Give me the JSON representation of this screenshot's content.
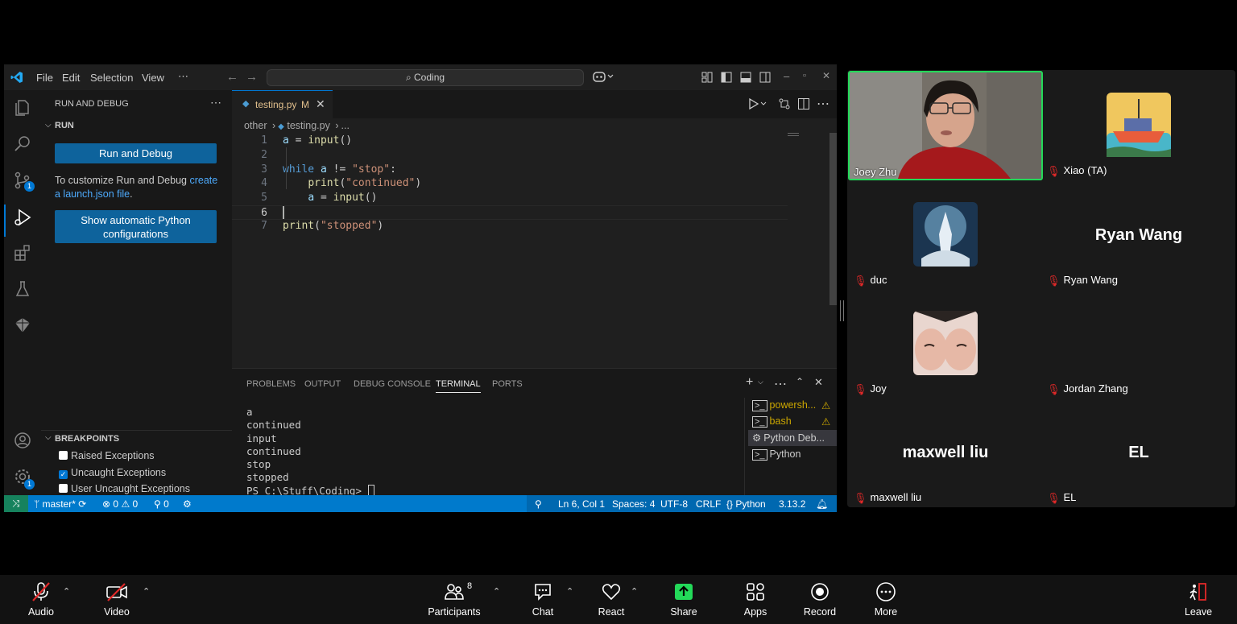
{
  "vscode": {
    "menu": [
      "File",
      "Edit",
      "Selection",
      "View",
      "⋯"
    ],
    "search_text": "Coding",
    "sidebar": {
      "title": "RUN AND DEBUG",
      "section": "RUN",
      "run_button": "Run and Debug",
      "customize_text": "To customize Run and Debug ",
      "create_link": "create",
      "launch_link": "a launch.json file",
      "period": ".",
      "python_button_1": "Show automatic Python",
      "python_button_2": "configurations",
      "breakpoints_title": "BREAKPOINTS",
      "breakpoints": [
        {
          "label": "Raised Exceptions",
          "checked": false
        },
        {
          "label": "Uncaught Exceptions",
          "checked": true
        },
        {
          "label": "User Uncaught Exceptions",
          "checked": false
        }
      ],
      "badge_scm": "1",
      "badge_settings": "1"
    },
    "tab": {
      "filename": "testing.py",
      "status": "M"
    },
    "breadcrumb": [
      "other",
      "testing.py",
      "..."
    ],
    "code": [
      {
        "n": "1",
        "text": "a = input()"
      },
      {
        "n": "2",
        "text": ""
      },
      {
        "n": "3",
        "text": "while a != \"stop\":"
      },
      {
        "n": "4",
        "text": "    print(\"continued\")"
      },
      {
        "n": "5",
        "text": "    a = input()"
      },
      {
        "n": "6",
        "text": ""
      },
      {
        "n": "7",
        "text": "print(\"stopped\")"
      }
    ],
    "panel_tabs": [
      "PROBLEMS",
      "OUTPUT",
      "DEBUG CONSOLE",
      "TERMINAL",
      "PORTS"
    ],
    "terminal_output": [
      "a",
      "continued",
      "input",
      "continued",
      "stop",
      "stopped",
      "PS C:\\Stuff\\Coding> "
    ],
    "terminals": [
      {
        "label": "powersh...",
        "warn": true
      },
      {
        "label": "bash",
        "warn": true
      },
      {
        "label": "Python Deb...",
        "warn": false
      },
      {
        "label": "Python",
        "warn": false
      }
    ],
    "status": {
      "branch": "master*",
      "errors": "0",
      "warnings": "0",
      "ports": "0",
      "position": "Ln 6, Col 1",
      "spaces": "Spaces: 4",
      "encoding": "UTF-8",
      "eol": "CRLF",
      "language": "Python",
      "version": "3.13.2"
    },
    "colors": {
      "accent": "#0078d4",
      "status": "#007acc",
      "button": "#0e639c"
    }
  },
  "gallery": {
    "participants": [
      {
        "name": "Joey Zhu",
        "muted": false,
        "video": true
      },
      {
        "name": "Xiao (TA)",
        "muted": true
      },
      {
        "name": "duc",
        "muted": true
      },
      {
        "name": "Ryan Wang",
        "muted": true,
        "display": "Ryan Wang"
      },
      {
        "name": "Joy",
        "muted": true
      },
      {
        "name": "Jordan Zhang",
        "muted": true
      },
      {
        "name": "maxwell liu",
        "muted": true,
        "display": "maxwell liu"
      },
      {
        "name": "EL",
        "muted": true,
        "display": "EL"
      }
    ],
    "active_color": "#23d959"
  },
  "toolbar": {
    "audio": "Audio",
    "video": "Video",
    "participants": "Participants",
    "participant_count": "8",
    "chat": "Chat",
    "react": "React",
    "share": "Share",
    "apps": "Apps",
    "record": "Record",
    "more": "More",
    "leave": "Leave"
  }
}
